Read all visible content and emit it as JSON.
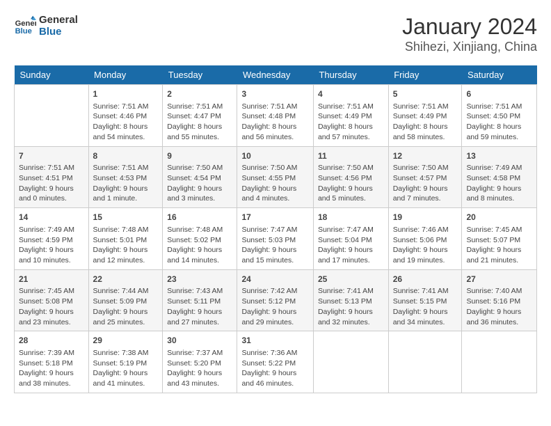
{
  "header": {
    "logo_line1": "General",
    "logo_line2": "Blue",
    "title": "January 2024",
    "subtitle": "Shihezi, Xinjiang, China"
  },
  "days_of_week": [
    "Sunday",
    "Monday",
    "Tuesday",
    "Wednesday",
    "Thursday",
    "Friday",
    "Saturday"
  ],
  "weeks": [
    [
      {
        "day": "",
        "info": ""
      },
      {
        "day": "1",
        "info": "Sunrise: 7:51 AM\nSunset: 4:46 PM\nDaylight: 8 hours\nand 54 minutes."
      },
      {
        "day": "2",
        "info": "Sunrise: 7:51 AM\nSunset: 4:47 PM\nDaylight: 8 hours\nand 55 minutes."
      },
      {
        "day": "3",
        "info": "Sunrise: 7:51 AM\nSunset: 4:48 PM\nDaylight: 8 hours\nand 56 minutes."
      },
      {
        "day": "4",
        "info": "Sunrise: 7:51 AM\nSunset: 4:49 PM\nDaylight: 8 hours\nand 57 minutes."
      },
      {
        "day": "5",
        "info": "Sunrise: 7:51 AM\nSunset: 4:49 PM\nDaylight: 8 hours\nand 58 minutes."
      },
      {
        "day": "6",
        "info": "Sunrise: 7:51 AM\nSunset: 4:50 PM\nDaylight: 8 hours\nand 59 minutes."
      }
    ],
    [
      {
        "day": "7",
        "info": "Sunrise: 7:51 AM\nSunset: 4:51 PM\nDaylight: 9 hours\nand 0 minutes."
      },
      {
        "day": "8",
        "info": "Sunrise: 7:51 AM\nSunset: 4:53 PM\nDaylight: 9 hours\nand 1 minute."
      },
      {
        "day": "9",
        "info": "Sunrise: 7:50 AM\nSunset: 4:54 PM\nDaylight: 9 hours\nand 3 minutes."
      },
      {
        "day": "10",
        "info": "Sunrise: 7:50 AM\nSunset: 4:55 PM\nDaylight: 9 hours\nand 4 minutes."
      },
      {
        "day": "11",
        "info": "Sunrise: 7:50 AM\nSunset: 4:56 PM\nDaylight: 9 hours\nand 5 minutes."
      },
      {
        "day": "12",
        "info": "Sunrise: 7:50 AM\nSunset: 4:57 PM\nDaylight: 9 hours\nand 7 minutes."
      },
      {
        "day": "13",
        "info": "Sunrise: 7:49 AM\nSunset: 4:58 PM\nDaylight: 9 hours\nand 8 minutes."
      }
    ],
    [
      {
        "day": "14",
        "info": "Sunrise: 7:49 AM\nSunset: 4:59 PM\nDaylight: 9 hours\nand 10 minutes."
      },
      {
        "day": "15",
        "info": "Sunrise: 7:48 AM\nSunset: 5:01 PM\nDaylight: 9 hours\nand 12 minutes."
      },
      {
        "day": "16",
        "info": "Sunrise: 7:48 AM\nSunset: 5:02 PM\nDaylight: 9 hours\nand 14 minutes."
      },
      {
        "day": "17",
        "info": "Sunrise: 7:47 AM\nSunset: 5:03 PM\nDaylight: 9 hours\nand 15 minutes."
      },
      {
        "day": "18",
        "info": "Sunrise: 7:47 AM\nSunset: 5:04 PM\nDaylight: 9 hours\nand 17 minutes."
      },
      {
        "day": "19",
        "info": "Sunrise: 7:46 AM\nSunset: 5:06 PM\nDaylight: 9 hours\nand 19 minutes."
      },
      {
        "day": "20",
        "info": "Sunrise: 7:45 AM\nSunset: 5:07 PM\nDaylight: 9 hours\nand 21 minutes."
      }
    ],
    [
      {
        "day": "21",
        "info": "Sunrise: 7:45 AM\nSunset: 5:08 PM\nDaylight: 9 hours\nand 23 minutes."
      },
      {
        "day": "22",
        "info": "Sunrise: 7:44 AM\nSunset: 5:09 PM\nDaylight: 9 hours\nand 25 minutes."
      },
      {
        "day": "23",
        "info": "Sunrise: 7:43 AM\nSunset: 5:11 PM\nDaylight: 9 hours\nand 27 minutes."
      },
      {
        "day": "24",
        "info": "Sunrise: 7:42 AM\nSunset: 5:12 PM\nDaylight: 9 hours\nand 29 minutes."
      },
      {
        "day": "25",
        "info": "Sunrise: 7:41 AM\nSunset: 5:13 PM\nDaylight: 9 hours\nand 32 minutes."
      },
      {
        "day": "26",
        "info": "Sunrise: 7:41 AM\nSunset: 5:15 PM\nDaylight: 9 hours\nand 34 minutes."
      },
      {
        "day": "27",
        "info": "Sunrise: 7:40 AM\nSunset: 5:16 PM\nDaylight: 9 hours\nand 36 minutes."
      }
    ],
    [
      {
        "day": "28",
        "info": "Sunrise: 7:39 AM\nSunset: 5:18 PM\nDaylight: 9 hours\nand 38 minutes."
      },
      {
        "day": "29",
        "info": "Sunrise: 7:38 AM\nSunset: 5:19 PM\nDaylight: 9 hours\nand 41 minutes."
      },
      {
        "day": "30",
        "info": "Sunrise: 7:37 AM\nSunset: 5:20 PM\nDaylight: 9 hours\nand 43 minutes."
      },
      {
        "day": "31",
        "info": "Sunrise: 7:36 AM\nSunset: 5:22 PM\nDaylight: 9 hours\nand 46 minutes."
      },
      {
        "day": "",
        "info": ""
      },
      {
        "day": "",
        "info": ""
      },
      {
        "day": "",
        "info": ""
      }
    ]
  ]
}
